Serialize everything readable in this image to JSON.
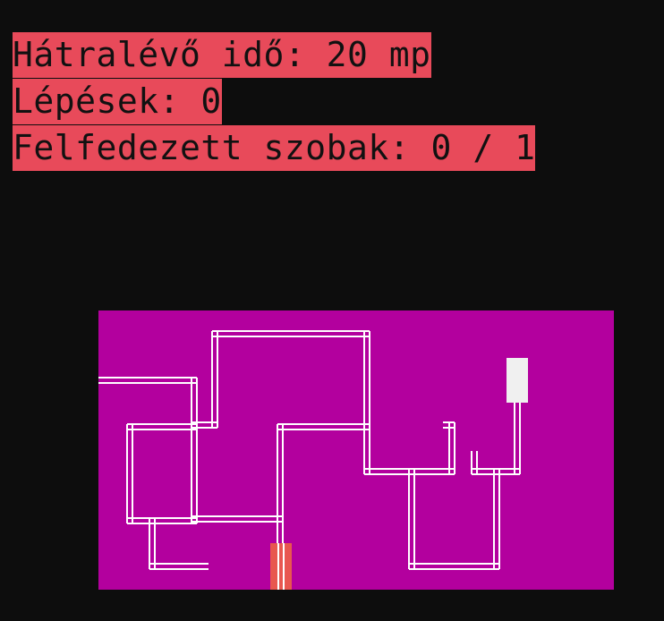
{
  "hud": {
    "time_remaining": "Hátralévő idő: 20 mp",
    "steps": "Lépések: 0",
    "rooms_explored": "Felfedezett szobak: 0 / 1"
  },
  "colors": {
    "page_background": "#0d0d0d",
    "hud_background": "#e84a5a",
    "hud_text": "#111111",
    "maze_background": "#b3009e",
    "corridor": "#ffffff",
    "room": "#f0f0f0",
    "player": "#e8574f"
  },
  "icons": {
    "room": "room-block",
    "player": "player-marker"
  }
}
